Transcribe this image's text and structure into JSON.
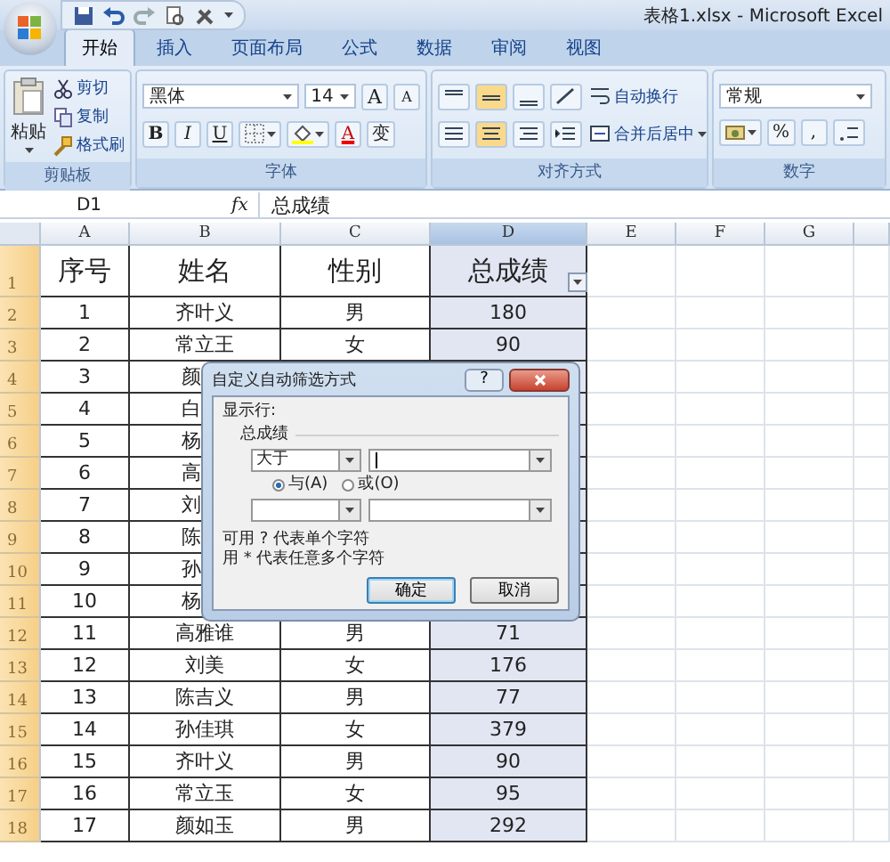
{
  "window": {
    "title": "表格1.xlsx - Microsoft Excel"
  },
  "tabs": [
    {
      "label": "开始",
      "selected": true
    },
    {
      "label": "插入",
      "selected": false
    },
    {
      "label": "页面布局",
      "selected": false
    },
    {
      "label": "公式",
      "selected": false
    },
    {
      "label": "数据",
      "selected": false
    },
    {
      "label": "审阅",
      "selected": false
    },
    {
      "label": "视图",
      "selected": false
    }
  ],
  "ribbon": {
    "clipboard": {
      "label": "剪贴板",
      "paste": "粘贴",
      "cut": "剪切",
      "copy": "复制",
      "format_painter": "格式刷"
    },
    "font": {
      "label": "字体",
      "font_name": "黑体",
      "font_size": "14",
      "grow": "A",
      "shrink": "A",
      "bold": "B",
      "italic": "I",
      "underline": "U",
      "font_color": "A",
      "phonetic": "变"
    },
    "alignment": {
      "label": "对齐方式",
      "wrap_text": "自动换行",
      "merge_center": "合并后居中"
    },
    "number": {
      "label": "数字",
      "format": "常规",
      "percent": "%",
      "comma": ","
    }
  },
  "formula_bar": {
    "name_box": "D1",
    "fx": "fx",
    "formula": "总成绩"
  },
  "sheet": {
    "columns": [
      {
        "label": "A",
        "selected": false,
        "filter": false
      },
      {
        "label": "B",
        "selected": false,
        "filter": false
      },
      {
        "label": "C",
        "selected": false,
        "filter": false
      },
      {
        "label": "D",
        "selected": true,
        "filter": true
      },
      {
        "label": "E",
        "selected": false,
        "filter": false
      },
      {
        "label": "F",
        "selected": false,
        "filter": false
      },
      {
        "label": "G",
        "selected": false,
        "filter": false
      }
    ],
    "rows": [
      {
        "header": "1",
        "selected": true,
        "kind": "title",
        "cells": [
          "序号",
          "姓名",
          "性别",
          "总成绩"
        ]
      },
      {
        "header": "2",
        "selected": true,
        "kind": "data",
        "cells": [
          "1",
          "齐叶义",
          "男",
          "180"
        ]
      },
      {
        "header": "3",
        "selected": true,
        "kind": "data",
        "cells": [
          "2",
          "常立王",
          "女",
          "90"
        ]
      },
      {
        "header": "4",
        "selected": true,
        "kind": "partial",
        "cells": [
          "3",
          "颜"
        ]
      },
      {
        "header": "5",
        "selected": true,
        "kind": "partial",
        "cells": [
          "4",
          "白"
        ]
      },
      {
        "header": "6",
        "selected": true,
        "kind": "partial",
        "cells": [
          "5",
          "杨"
        ]
      },
      {
        "header": "7",
        "selected": true,
        "kind": "partial",
        "cells": [
          "6",
          "高"
        ]
      },
      {
        "header": "8",
        "selected": true,
        "kind": "partial",
        "cells": [
          "7",
          "刘"
        ]
      },
      {
        "header": "9",
        "selected": true,
        "kind": "partial",
        "cells": [
          "8",
          "陈"
        ]
      },
      {
        "header": "10",
        "selected": true,
        "kind": "partial",
        "cells": [
          "9",
          "孙"
        ]
      },
      {
        "header": "11",
        "selected": true,
        "kind": "partial",
        "cells": [
          "10",
          "杨"
        ]
      },
      {
        "header": "12",
        "selected": true,
        "kind": "data",
        "cells": [
          "11",
          "高雅谁",
          "男",
          "71"
        ]
      },
      {
        "header": "13",
        "selected": true,
        "kind": "data",
        "cells": [
          "12",
          "刘美",
          "女",
          "176"
        ]
      },
      {
        "header": "14",
        "selected": true,
        "kind": "data",
        "cells": [
          "13",
          "陈吉义",
          "男",
          "77"
        ]
      },
      {
        "header": "15",
        "selected": true,
        "kind": "data",
        "cells": [
          "14",
          "孙佳琪",
          "女",
          "379"
        ]
      },
      {
        "header": "16",
        "selected": true,
        "kind": "data",
        "cells": [
          "15",
          "齐叶义",
          "男",
          "90"
        ]
      },
      {
        "header": "17",
        "selected": true,
        "kind": "data",
        "cells": [
          "16",
          "常立玉",
          "女",
          "95"
        ]
      },
      {
        "header": "18",
        "selected": true,
        "kind": "data",
        "cells": [
          "17",
          "颜如玉",
          "男",
          "292"
        ]
      }
    ]
  },
  "dialog": {
    "title": "自定义自动筛选方式",
    "help": "?",
    "section": "显示行:",
    "field": "总成绩",
    "operator_1": "大于",
    "radios": [
      {
        "label": "与(A)",
        "selected": true
      },
      {
        "label": "或(O)",
        "selected": false
      }
    ],
    "hints": [
      "可用 ? 代表单个字符",
      "用 * 代表任意多个字符"
    ],
    "buttons": [
      "确定",
      "取消"
    ]
  }
}
